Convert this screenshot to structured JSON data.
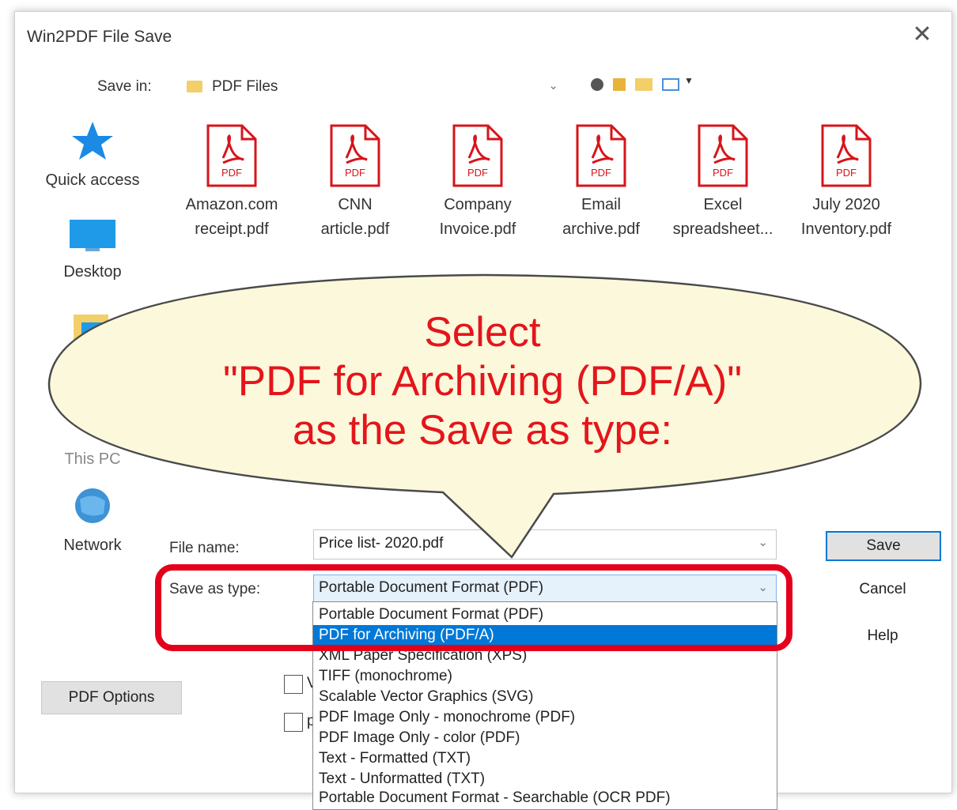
{
  "window": {
    "title": "Win2PDF File Save"
  },
  "save_in": {
    "label": "Save in:",
    "value": "PDF Files"
  },
  "places": [
    {
      "label": "Quick access",
      "icon": "star-icon"
    },
    {
      "label": "Desktop",
      "icon": "desktop-icon"
    },
    {
      "label": "",
      "icon": "libraries-icon"
    },
    {
      "label": "This PC",
      "icon": "computer-icon"
    },
    {
      "label": "Network",
      "icon": "network-icon"
    }
  ],
  "files": [
    {
      "line1": "Amazon.com",
      "line2": "receipt.pdf"
    },
    {
      "line1": "CNN",
      "line2": "article.pdf"
    },
    {
      "line1": "Company",
      "line2": "Invoice.pdf"
    },
    {
      "line1": "Email",
      "line2": "archive.pdf"
    },
    {
      "line1": "Excel",
      "line2": "spreadsheet..."
    },
    {
      "line1": "July 2020",
      "line2": "Inventory.pdf"
    }
  ],
  "pdf_badge": "PDF",
  "file_name": {
    "label": "File name:",
    "value": "Price list- 2020.pdf"
  },
  "save_as_type": {
    "label": "Save as type:",
    "value": "Portable Document Format (PDF)",
    "options": [
      "Portable Document Format (PDF)",
      "PDF for Archiving (PDF/A)",
      "XML Paper Specification (XPS)",
      "TIFF (monochrome)",
      "Scalable Vector Graphics (SVG)",
      "PDF Image Only - monochrome (PDF)",
      "PDF Image Only - color (PDF)",
      "Text - Formatted (TXT)",
      "Text - Unformatted (TXT)",
      "Portable Document Format - Searchable (OCR PDF)"
    ],
    "selected_index": 1
  },
  "buttons": {
    "save": "Save",
    "cancel": "Cancel",
    "help": "Help",
    "pdf_options": "PDF Options"
  },
  "checkboxes": [
    {
      "label": "V"
    },
    {
      "label": "p"
    }
  ],
  "callout": {
    "line1": "Select",
    "line2": "\"PDF for Archiving (PDF/A)\"",
    "line3": "as the Save as type:"
  },
  "colors": {
    "accent": "#0078d7",
    "callout_text": "#e4151b",
    "highlight": "#e4001b",
    "pdf_red": "#d7141a",
    "bubble": "#fbf8dc"
  }
}
